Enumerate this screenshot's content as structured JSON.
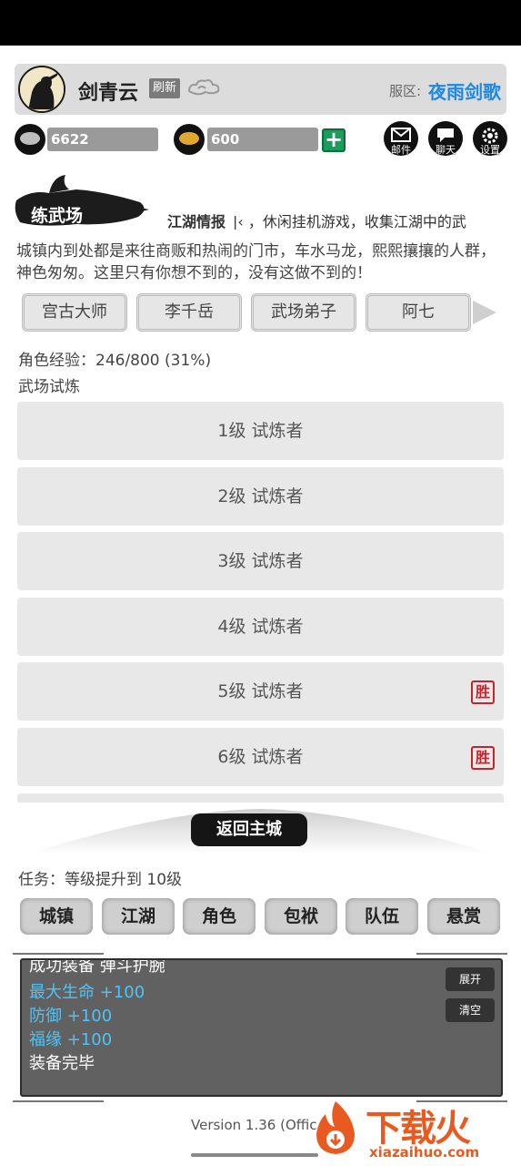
{
  "header": {
    "player_name": "剑青云",
    "refresh_label": "刷新",
    "server_label": "服区:",
    "server_name": "夜雨剑歌"
  },
  "currency": {
    "silver": "6622",
    "gold": "600"
  },
  "top_icons": {
    "mail": "邮件",
    "chat": "聊天",
    "settings": "设置"
  },
  "location": {
    "name": "练武场",
    "news_label": "江湖情报",
    "news_text": "|‹ ，休闲挂机游戏，收集江湖中的武",
    "description": "城镇内到处都是来往商贩和热闹的门市，车水马龙，熙熙攘攘的人群，神色匆匆。这里只有你想不到的，没有这做不到的！"
  },
  "npcs": [
    "宫古大师",
    "李千岳",
    "武场弟子",
    "阿七"
  ],
  "exp_text": "角色经验：246/800 (31%)",
  "section_title": "武场试炼",
  "trials": [
    {
      "label": "1级 试炼者",
      "won": false
    },
    {
      "label": "2级 试炼者",
      "won": false
    },
    {
      "label": "3级 试炼者",
      "won": false
    },
    {
      "label": "4级 试炼者",
      "won": false
    },
    {
      "label": "5级 试炼者",
      "won": true
    },
    {
      "label": "6级 试炼者",
      "won": true
    }
  ],
  "win_seal_text": "胜",
  "return_label": "返回主城",
  "task_text": "任务：等级提升到 10级",
  "nav": [
    "城镇",
    "江湖",
    "角色",
    "包袱",
    "队伍",
    "悬赏"
  ],
  "log": {
    "lines": [
      {
        "text": "成功装备 弹斗护腕",
        "color": "#ffffff"
      },
      {
        "text": "最大生命 +100",
        "color": "#4fc3f7"
      },
      {
        "text": "防御 +100",
        "color": "#4fc3f7"
      },
      {
        "text": "福缘 +100",
        "color": "#4fc3f7"
      },
      {
        "text": "装备完毕",
        "color": "#ffffff"
      }
    ],
    "expand_label": "展开",
    "clear_label": "清空"
  },
  "version": "Version 1.36 (Offic",
  "watermark": {
    "title": "下载火",
    "url": "xiazaihuo.com"
  },
  "colors": {
    "accent": "#1e88e5",
    "win_red": "#c8232c",
    "log_blue": "#4fc3f7",
    "watermark_orange": "#e85a20"
  }
}
